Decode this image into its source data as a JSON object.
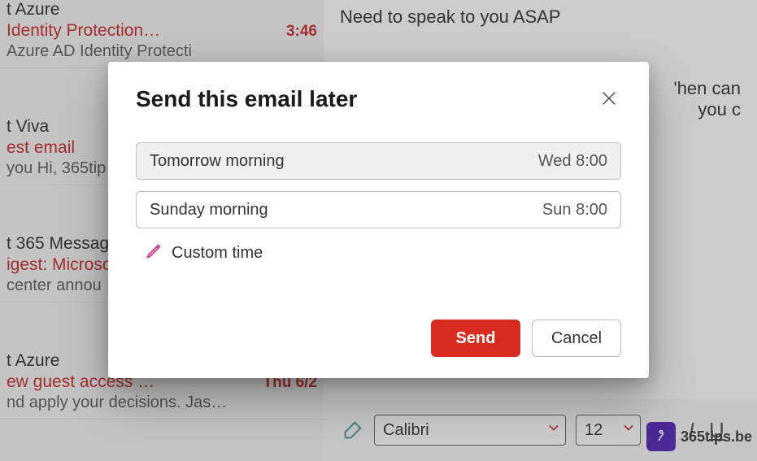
{
  "mailList": {
    "items": [
      {
        "sender": "t Azure",
        "subject": " Identity Protection…",
        "time": "3:46",
        "snippet": " Azure AD Identity Protecti"
      },
      {
        "sender": "t Viva",
        "subject": "est email",
        "time": "",
        "snippet": " you Hi, 365tip"
      },
      {
        "sender": "t 365 Message",
        "subject": "igest: Microsc",
        "time": "",
        "snippet": "center annou"
      },
      {
        "sender": "t Azure",
        "subject": "ew guest access …",
        "time": "Thu 6/2",
        "snippet": "nd apply your decisions. Jas…"
      }
    ]
  },
  "reading": {
    "top_line": "Need to speak to you ASAP",
    "body_fragment": "'hen can you c"
  },
  "toolbar": {
    "font_name": "Calibri",
    "font_size": "12"
  },
  "watermark": {
    "text": "365tips.be"
  },
  "dialog": {
    "title": "Send this email later",
    "options": [
      {
        "label": "Tomorrow morning",
        "when": "Wed 8:00",
        "selected": true
      },
      {
        "label": "Sunday morning",
        "when": "Sun 8:00",
        "selected": false
      }
    ],
    "custom_label": "Custom time",
    "send_label": "Send",
    "cancel_label": "Cancel"
  }
}
